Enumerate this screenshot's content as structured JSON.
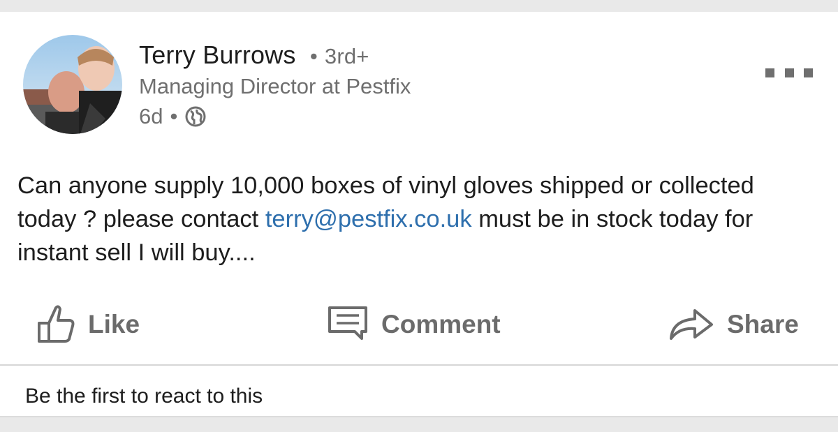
{
  "post": {
    "author": {
      "name": "Terry Burrows",
      "degree": "3rd+",
      "headline": "Managing Director at Pestfix"
    },
    "meta": {
      "age": "6d",
      "visibility_icon": "globe-icon"
    },
    "more_icon": "more-options-icon",
    "text": {
      "before_link": "Can anyone supply 10,000 boxes of vinyl gloves shipped or collected today ? please contact ",
      "link": "terry@pestfix.co.uk",
      "after_link": " must be in stock today for instant sell I will buy...."
    },
    "actions": {
      "like": {
        "label": "Like",
        "icon": "thumbs-up-icon"
      },
      "comment": {
        "label": "Comment",
        "icon": "comment-icon"
      },
      "share": {
        "label": "Share",
        "icon": "share-arrow-icon"
      }
    },
    "reactions_text": "Be the first to react to this"
  },
  "colors": {
    "link": "#2e6fad",
    "text": "#1d1d1d",
    "muted": "#6f6f6f",
    "background": "#e9e9e9"
  }
}
